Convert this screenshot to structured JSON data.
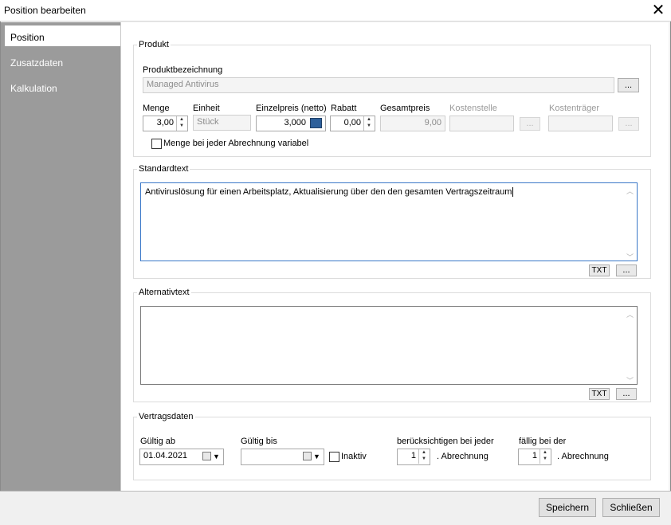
{
  "window": {
    "title": "Position bearbeiten"
  },
  "sidebar": {
    "items": [
      {
        "label": "Position"
      },
      {
        "label": "Zusatzdaten"
      },
      {
        "label": "Kalkulation"
      }
    ]
  },
  "produkt": {
    "group_label": "Produkt",
    "bezeichnung_label": "Produktbezeichnung",
    "bezeichnung_value": "Managed Antivirus",
    "ellipsis": "...",
    "menge_label": "Menge",
    "menge_value": "3,00",
    "einheit_label": "Einheit",
    "einheit_value": "Stück",
    "einzelpreis_label": "Einzelpreis (netto)",
    "einzelpreis_value": "3,000",
    "rabatt_label": "Rabatt",
    "rabatt_value": "0,00",
    "gesamtpreis_label": "Gesamtpreis",
    "gesamtpreis_value": "9,00",
    "kostenstelle_label": "Kostenstelle",
    "kostenstelle_value": "",
    "kostentraeger_label": "Kostenträger",
    "kostentraeger_value": "",
    "menge_variabel_label": "Menge bei jeder Abrechnung variabel"
  },
  "standardtext": {
    "group_label": "Standardtext",
    "text": "Antiviruslösung für einen Arbeitsplatz, Aktualisierung über den den gesamten Vertragszeitraum",
    "txt_button": "TXT",
    "more_button": "..."
  },
  "alternativtext": {
    "group_label": "Alternativtext",
    "text": "",
    "txt_button": "TXT",
    "more_button": "..."
  },
  "vertragsdaten": {
    "group_label": "Vertragsdaten",
    "gueltig_ab_label": "Gültig ab",
    "gueltig_ab_value": "01.04.2021",
    "gueltig_bis_label": "Gültig bis",
    "gueltig_bis_value": "",
    "inaktiv_label": "Inaktiv",
    "beruecksichtigen_label": "berücksichtigen bei jeder",
    "beruecksichtigen_value": "1",
    "faellig_label": "fällig bei der",
    "faellig_value": "1",
    "abrechnung_suffix": ". Abrechnung"
  },
  "footer": {
    "save_label": "Speichern",
    "close_label": "Schließen"
  }
}
